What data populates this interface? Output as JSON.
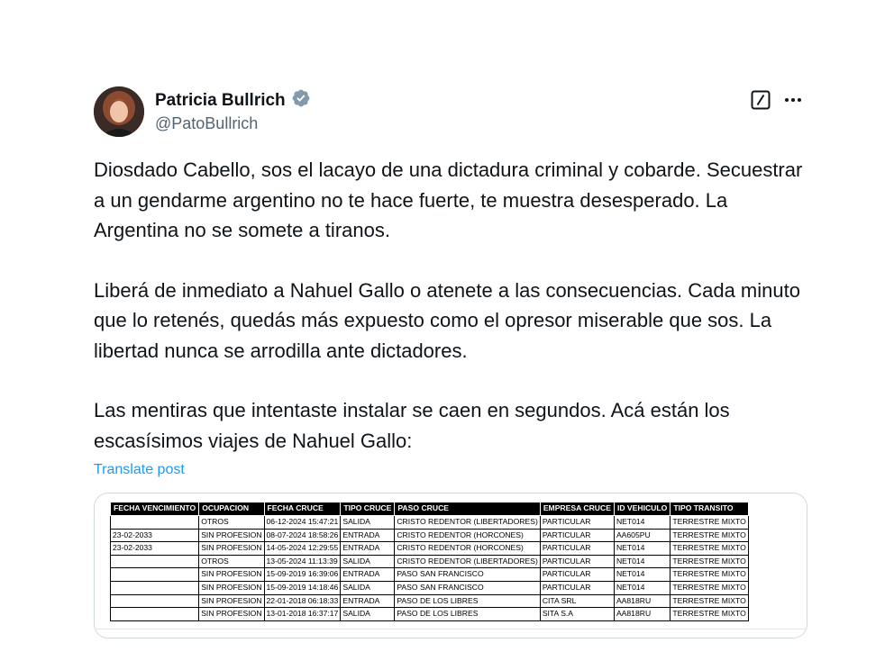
{
  "author": {
    "display_name": "Patricia Bullrich",
    "handle": "@PatoBullrich"
  },
  "icons": {
    "verified": "verified-badge-icon",
    "grok": "grok-icon",
    "more": "more-dots-icon"
  },
  "colors": {
    "link": "#1d9bf0",
    "verified": "#829aab",
    "secondary_text": "#536471"
  },
  "post": {
    "paragraphs": [
      "Diosdado Cabello, sos el lacayo de una dictadura criminal y cobarde. Secuestrar a un gendarme argentino no te hace fuerte, te muestra desesperado. La Argentina no se somete a tiranos.",
      "Liberá de inmediato a Nahuel Gallo o atenete a las consecuencias. Cada minuto que lo retenés, quedás más expuesto como el opresor miserable que sos. La libertad nunca se arrodilla ante dictadores.",
      "Las mentiras que intentaste instalar se caen en segundos. Acá están los escasísimos viajes de Nahuel Gallo:"
    ],
    "translate_label": "Translate post"
  },
  "media_table": {
    "headers": [
      "FECHA VENCIMIENTO",
      "OCUPACION",
      "FECHA CRUCE",
      "TIPO CRUCE",
      "PASO CRUCE",
      "EMPRESA CRUCE",
      "ID VEHICULO",
      "TIPO TRANSITO"
    ],
    "rows": [
      [
        "",
        "OTROS",
        "06-12-2024 15:47:21",
        "SALIDA",
        "CRISTO REDENTOR (LIBERTADORES)",
        "PARTICULAR",
        "NET014",
        "TERRESTRE MIXTO"
      ],
      [
        "23-02-2033",
        "SIN PROFESION",
        "08-07-2024 18:58:26",
        "ENTRADA",
        "CRISTO REDENTOR (HORCONES)",
        "PARTICULAR",
        "AA605PU",
        "TERRESTRE MIXTO"
      ],
      [
        "23-02-2033",
        "SIN PROFESION",
        "14-05-2024 12:29:55",
        "ENTRADA",
        "CRISTO REDENTOR (HORCONES)",
        "PARTICULAR",
        "NET014",
        "TERRESTRE MIXTO"
      ],
      [
        "",
        "OTROS",
        "13-05-2024 11:13:39",
        "SALIDA",
        "CRISTO REDENTOR (LIBERTADORES)",
        "PARTICULAR",
        "NET014",
        "TERRESTRE MIXTO"
      ],
      [
        "",
        "SIN PROFESION",
        "15-09-2019 16:39:06",
        "ENTRADA",
        "PASO SAN FRANCISCO",
        "PARTICULAR",
        "NET014",
        "TERRESTRE MIXTO"
      ],
      [
        "",
        "SIN PROFESION",
        "15-09-2019 14:18:46",
        "SALIDA",
        "PASO SAN FRANCISCO",
        "PARTICULAR",
        "NET014",
        "TERRESTRE MIXTO"
      ],
      [
        "",
        "SIN PROFESION",
        "22-01-2018 06:18:33",
        "ENTRADA",
        "PASO DE LOS LIBRES",
        "CITA SRL",
        "AA818RU",
        "TERRESTRE MIXTO"
      ],
      [
        "",
        "SIN PROFESION",
        "13-01-2018 16:37:17",
        "SALIDA",
        "PASO DE LOS LIBRES",
        "SITA S.A",
        "AA818RU",
        "TERRESTRE MIXTO"
      ]
    ]
  }
}
